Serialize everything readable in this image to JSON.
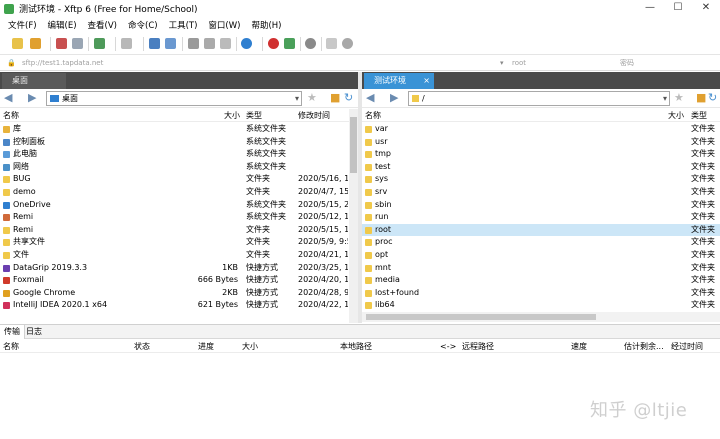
{
  "window": {
    "title": "测试环境 - Xftp 6 (Free for Home/School)",
    "minimize": "—",
    "maximize": "☐",
    "close": "✕"
  },
  "menu": [
    "文件(F)",
    "编辑(E)",
    "查看(V)",
    "命令(C)",
    "工具(T)",
    "窗口(W)",
    "帮助(H)"
  ],
  "address": {
    "host": "sftp://test1.tapdata.net",
    "user": "root",
    "password": "密码"
  },
  "left_pane": {
    "tab": "桌面",
    "path": "桌面",
    "columns": {
      "name": "名称",
      "size": "大小",
      "type": "类型",
      "modified": "修改时间"
    },
    "rows": [
      {
        "name": "库",
        "size": "",
        "type": "系统文件夹",
        "modified": "",
        "icon": "library-icon",
        "color": "#e8b33c"
      },
      {
        "name": "控制面板",
        "size": "",
        "type": "系统文件夹",
        "modified": "",
        "icon": "control-panel-icon",
        "color": "#4b86c8"
      },
      {
        "name": "此电脑",
        "size": "",
        "type": "系统文件夹",
        "modified": "",
        "icon": "computer-icon",
        "color": "#5a9bd8"
      },
      {
        "name": "网络",
        "size": "",
        "type": "系统文件夹",
        "modified": "",
        "icon": "network-icon",
        "color": "#4a90c8"
      },
      {
        "name": "BUG",
        "size": "",
        "type": "文件夹",
        "modified": "2020/5/16, 1",
        "icon": "folder-icon",
        "color": "#f0c94a"
      },
      {
        "name": "demo",
        "size": "",
        "type": "文件夹",
        "modified": "2020/4/7, 15:",
        "icon": "folder-icon",
        "color": "#f0c94a"
      },
      {
        "name": "OneDrive",
        "size": "",
        "type": "系统文件夹",
        "modified": "2020/5/15, 2",
        "icon": "cloud-icon",
        "color": "#2f7fd0"
      },
      {
        "name": "Remi",
        "size": "",
        "type": "系统文件夹",
        "modified": "2020/5/12, 1",
        "icon": "user-icon",
        "color": "#d06a3a"
      },
      {
        "name": "Remi",
        "size": "",
        "type": "文件夹",
        "modified": "2020/5/15, 1",
        "icon": "folder-icon",
        "color": "#f0c94a"
      },
      {
        "name": "共享文件",
        "size": "",
        "type": "文件夹",
        "modified": "2020/5/9, 9:5",
        "icon": "folder-icon",
        "color": "#f0c94a"
      },
      {
        "name": "文件",
        "size": "",
        "type": "文件夹",
        "modified": "2020/4/21, 1",
        "icon": "folder-icon",
        "color": "#f0c94a"
      },
      {
        "name": "DataGrip 2019.3.3",
        "size": "1KB",
        "type": "快捷方式",
        "modified": "2020/3/25, 1",
        "icon": "datagrip-icon",
        "color": "#6b3fb0"
      },
      {
        "name": "Foxmail",
        "size": "666 Bytes",
        "type": "快捷方式",
        "modified": "2020/4/20, 1",
        "icon": "foxmail-icon",
        "color": "#d03a2a"
      },
      {
        "name": "Google Chrome",
        "size": "2KB",
        "type": "快捷方式",
        "modified": "2020/4/28, 9",
        "icon": "chrome-icon",
        "color": "#e0a020"
      },
      {
        "name": "IntelliJ IDEA 2020.1 x64",
        "size": "621 Bytes",
        "type": "快捷方式",
        "modified": "2020/4/22, 1",
        "icon": "intellij-icon",
        "color": "#d0305a"
      }
    ]
  },
  "right_pane": {
    "tab": "测试环境",
    "tab_close": "×",
    "path": "/",
    "columns": {
      "name": "名称",
      "size": "大小",
      "type": "类型"
    },
    "rows": [
      {
        "name": "var",
        "type": "文件夹"
      },
      {
        "name": "usr",
        "type": "文件夹"
      },
      {
        "name": "tmp",
        "type": "文件夹"
      },
      {
        "name": "test",
        "type": "文件夹"
      },
      {
        "name": "sys",
        "type": "文件夹"
      },
      {
        "name": "srv",
        "type": "文件夹"
      },
      {
        "name": "sbin",
        "type": "文件夹"
      },
      {
        "name": "run",
        "type": "文件夹"
      },
      {
        "name": "root",
        "type": "文件夹"
      },
      {
        "name": "proc",
        "type": "文件夹"
      },
      {
        "name": "opt",
        "type": "文件夹"
      },
      {
        "name": "mnt",
        "type": "文件夹"
      },
      {
        "name": "media",
        "type": "文件夹"
      },
      {
        "name": "lost+found",
        "type": "文件夹"
      },
      {
        "name": "lib64",
        "type": "文件夹"
      }
    ],
    "selected": "root"
  },
  "bottom": {
    "tabs": [
      "传输",
      "日志"
    ],
    "columns": [
      "名称",
      "状态",
      "进度",
      "大小",
      "本地路径",
      "<->",
      "远程路径",
      "速度",
      "估计剩余...",
      "经过时间"
    ]
  },
  "watermark": "知乎 @ltjie"
}
